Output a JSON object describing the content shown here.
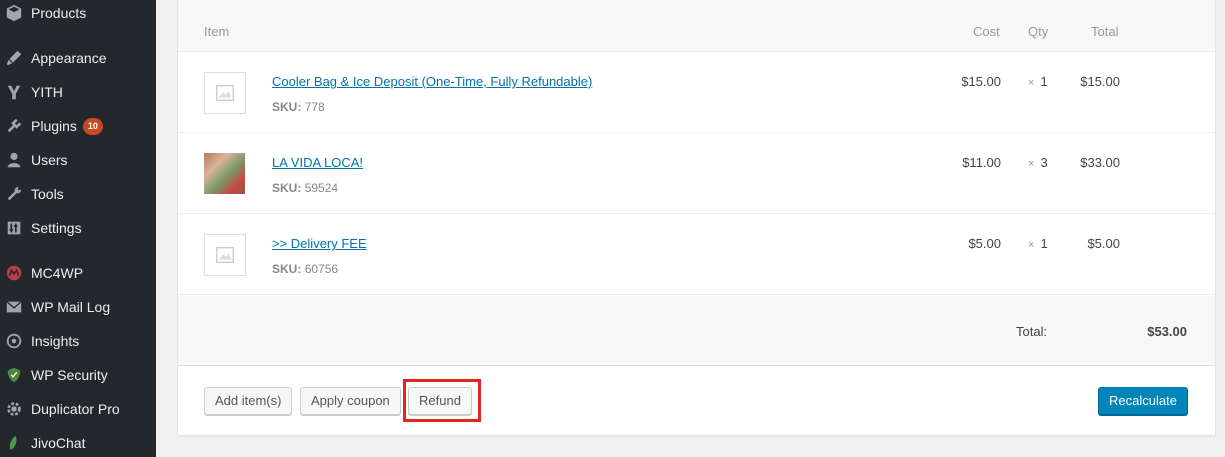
{
  "sidebar": {
    "items": [
      {
        "label": "Products",
        "icon": "products-icon"
      },
      {
        "label": "Appearance",
        "icon": "appearance-icon"
      },
      {
        "label": "YITH",
        "icon": "yith-icon"
      },
      {
        "label": "Plugins",
        "icon": "plugins-icon",
        "badge": "10"
      },
      {
        "label": "Users",
        "icon": "users-icon"
      },
      {
        "label": "Tools",
        "icon": "tools-icon"
      },
      {
        "label": "Settings",
        "icon": "settings-icon"
      },
      {
        "label": "MC4WP",
        "icon": "mc4wp-icon"
      },
      {
        "label": "WP Mail Log",
        "icon": "mail-icon"
      },
      {
        "label": "Insights",
        "icon": "insights-icon"
      },
      {
        "label": "WP Security",
        "icon": "shield-icon"
      },
      {
        "label": "Duplicator Pro",
        "icon": "gear-icon"
      },
      {
        "label": "JivoChat",
        "icon": "leaf-icon"
      }
    ]
  },
  "table": {
    "headers": {
      "item": "Item",
      "cost": "Cost",
      "qty": "Qty",
      "total": "Total"
    },
    "rows": [
      {
        "name": "Cooler Bag & Ice Deposit (One-Time, Fully Refundable)",
        "sku_label": "SKU:",
        "sku": "778",
        "cost": "$15.00",
        "qty_sign": "×",
        "qty": "1",
        "total": "$15.00",
        "thumb": "placeholder"
      },
      {
        "name": "LA VIDA LOCA!",
        "sku_label": "SKU:",
        "sku": "59524",
        "cost": "$11.00",
        "qty_sign": "×",
        "qty": "3",
        "total": "$33.00",
        "thumb": "photo"
      },
      {
        "name": ">> Delivery FEE",
        "sku_label": "SKU:",
        "sku": "60756",
        "cost": "$5.00",
        "qty_sign": "×",
        "qty": "1",
        "total": "$5.00",
        "thumb": "placeholder"
      }
    ]
  },
  "totals": {
    "label": "Total:",
    "value": "$53.00"
  },
  "actions": {
    "add_items": "Add item(s)",
    "apply_coupon": "Apply coupon",
    "refund": "Refund",
    "recalculate": "Recalculate"
  },
  "colors": {
    "sidebar_bg": "#23282d",
    "link": "#0073aa",
    "primary": "#0085ba",
    "badge": "#ca4a1f",
    "highlight": "#e8231e"
  }
}
